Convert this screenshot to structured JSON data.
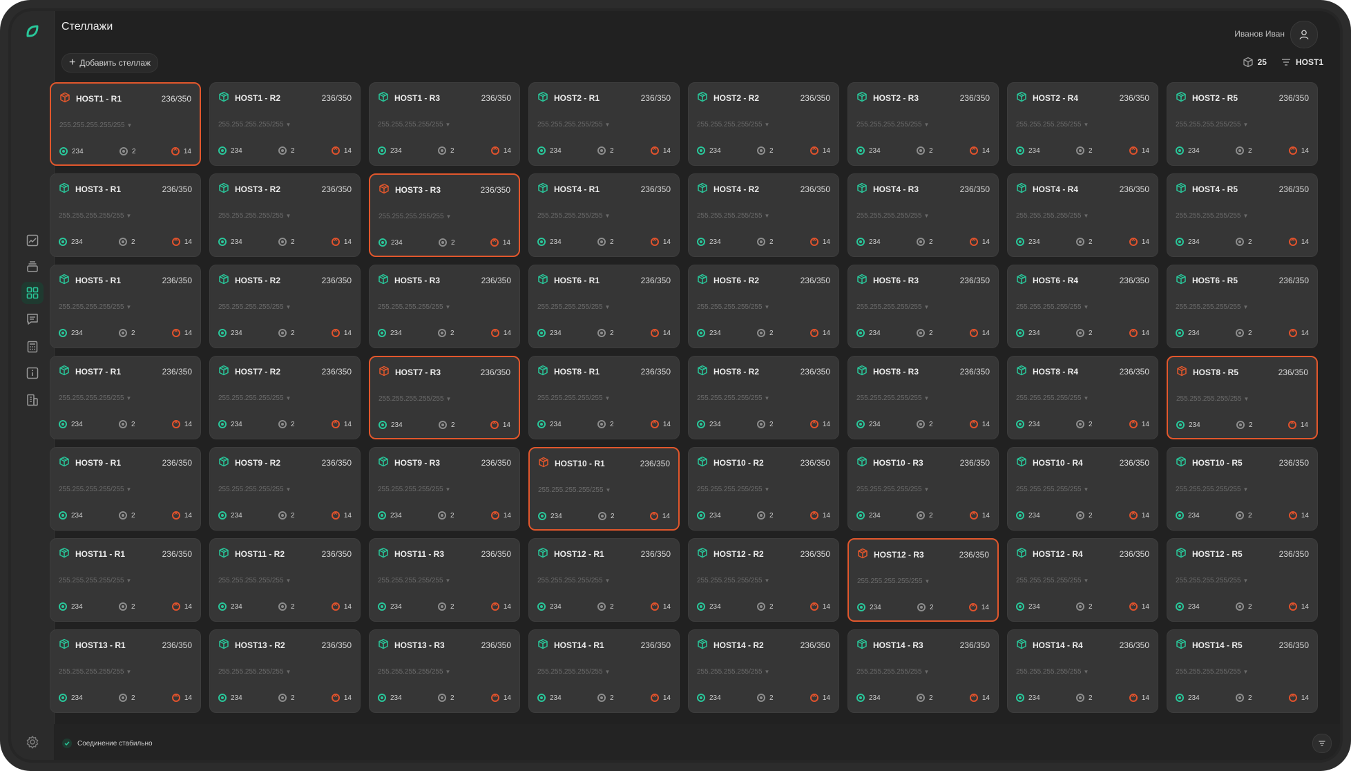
{
  "app": {
    "page_title": "Стеллажи",
    "user_name": "Иванов Иван",
    "add_button_label": "Добавить стеллаж",
    "rack_count": "25",
    "filter_host": "HOST1",
    "footer_status": "Соединение стабильно"
  },
  "colors": {
    "accent": "#29c79a",
    "alert": "#e2572c",
    "background": "#212121",
    "card": "#363636"
  },
  "sidebar": {
    "items": [
      {
        "icon": "chart-icon"
      },
      {
        "icon": "layers-icon"
      },
      {
        "icon": "grid-icon",
        "active": true
      },
      {
        "icon": "message-icon"
      },
      {
        "icon": "calculator-icon"
      },
      {
        "icon": "info-icon"
      },
      {
        "icon": "building-icon"
      }
    ]
  },
  "racks": [
    {
      "name": "HOST1 - R1",
      "capacity": "236/350",
      "ip": "255.255.255.255/255",
      "ok": "234",
      "warn": "2",
      "err": "14",
      "alert": true
    },
    {
      "name": "HOST1 - R2",
      "capacity": "236/350",
      "ip": "255.255.255.255/255",
      "ok": "234",
      "warn": "2",
      "err": "14",
      "alert": false
    },
    {
      "name": "HOST1 - R3",
      "capacity": "236/350",
      "ip": "255.255.255.255/255",
      "ok": "234",
      "warn": "2",
      "err": "14",
      "alert": false
    },
    {
      "name": "HOST2 - R1",
      "capacity": "236/350",
      "ip": "255.255.255.255/255",
      "ok": "234",
      "warn": "2",
      "err": "14",
      "alert": false
    },
    {
      "name": "HOST2 - R2",
      "capacity": "236/350",
      "ip": "255.255.255.255/255",
      "ok": "234",
      "warn": "2",
      "err": "14",
      "alert": false
    },
    {
      "name": "HOST2 - R3",
      "capacity": "236/350",
      "ip": "255.255.255.255/255",
      "ok": "234",
      "warn": "2",
      "err": "14",
      "alert": false
    },
    {
      "name": "HOST2 - R4",
      "capacity": "236/350",
      "ip": "255.255.255.255/255",
      "ok": "234",
      "warn": "2",
      "err": "14",
      "alert": false
    },
    {
      "name": "HOST2 - R5",
      "capacity": "236/350",
      "ip": "255.255.255.255/255",
      "ok": "234",
      "warn": "2",
      "err": "14",
      "alert": false
    },
    {
      "name": "HOST3 - R1",
      "capacity": "236/350",
      "ip": "255.255.255.255/255",
      "ok": "234",
      "warn": "2",
      "err": "14",
      "alert": false
    },
    {
      "name": "HOST3 - R2",
      "capacity": "236/350",
      "ip": "255.255.255.255/255",
      "ok": "234",
      "warn": "2",
      "err": "14",
      "alert": false
    },
    {
      "name": "HOST3 - R3",
      "capacity": "236/350",
      "ip": "255.255.255.255/255",
      "ok": "234",
      "warn": "2",
      "err": "14",
      "alert": true
    },
    {
      "name": "HOST4 - R1",
      "capacity": "236/350",
      "ip": "255.255.255.255/255",
      "ok": "234",
      "warn": "2",
      "err": "14",
      "alert": false
    },
    {
      "name": "HOST4 - R2",
      "capacity": "236/350",
      "ip": "255.255.255.255/255",
      "ok": "234",
      "warn": "2",
      "err": "14",
      "alert": false
    },
    {
      "name": "HOST4 - R3",
      "capacity": "236/350",
      "ip": "255.255.255.255/255",
      "ok": "234",
      "warn": "2",
      "err": "14",
      "alert": false
    },
    {
      "name": "HOST4 - R4",
      "capacity": "236/350",
      "ip": "255.255.255.255/255",
      "ok": "234",
      "warn": "2",
      "err": "14",
      "alert": false
    },
    {
      "name": "HOST4 - R5",
      "capacity": "236/350",
      "ip": "255.255.255.255/255",
      "ok": "234",
      "warn": "2",
      "err": "14",
      "alert": false
    },
    {
      "name": "HOST5 - R1",
      "capacity": "236/350",
      "ip": "255.255.255.255/255",
      "ok": "234",
      "warn": "2",
      "err": "14",
      "alert": false
    },
    {
      "name": "HOST5 - R2",
      "capacity": "236/350",
      "ip": "255.255.255.255/255",
      "ok": "234",
      "warn": "2",
      "err": "14",
      "alert": false
    },
    {
      "name": "HOST5 - R3",
      "capacity": "236/350",
      "ip": "255.255.255.255/255",
      "ok": "234",
      "warn": "2",
      "err": "14",
      "alert": false
    },
    {
      "name": "HOST6 - R1",
      "capacity": "236/350",
      "ip": "255.255.255.255/255",
      "ok": "234",
      "warn": "2",
      "err": "14",
      "alert": false
    },
    {
      "name": "HOST6 - R2",
      "capacity": "236/350",
      "ip": "255.255.255.255/255",
      "ok": "234",
      "warn": "2",
      "err": "14",
      "alert": false
    },
    {
      "name": "HOST6 - R3",
      "capacity": "236/350",
      "ip": "255.255.255.255/255",
      "ok": "234",
      "warn": "2",
      "err": "14",
      "alert": false
    },
    {
      "name": "HOST6 - R4",
      "capacity": "236/350",
      "ip": "255.255.255.255/255",
      "ok": "234",
      "warn": "2",
      "err": "14",
      "alert": false
    },
    {
      "name": "HOST6 - R5",
      "capacity": "236/350",
      "ip": "255.255.255.255/255",
      "ok": "234",
      "warn": "2",
      "err": "14",
      "alert": false
    },
    {
      "name": "HOST7 - R1",
      "capacity": "236/350",
      "ip": "255.255.255.255/255",
      "ok": "234",
      "warn": "2",
      "err": "14",
      "alert": false
    },
    {
      "name": "HOST7 - R2",
      "capacity": "236/350",
      "ip": "255.255.255.255/255",
      "ok": "234",
      "warn": "2",
      "err": "14",
      "alert": false
    },
    {
      "name": "HOST7 - R3",
      "capacity": "236/350",
      "ip": "255.255.255.255/255",
      "ok": "234",
      "warn": "2",
      "err": "14",
      "alert": true
    },
    {
      "name": "HOST8 - R1",
      "capacity": "236/350",
      "ip": "255.255.255.255/255",
      "ok": "234",
      "warn": "2",
      "err": "14",
      "alert": false
    },
    {
      "name": "HOST8 - R2",
      "capacity": "236/350",
      "ip": "255.255.255.255/255",
      "ok": "234",
      "warn": "2",
      "err": "14",
      "alert": false
    },
    {
      "name": "HOST8 - R3",
      "capacity": "236/350",
      "ip": "255.255.255.255/255",
      "ok": "234",
      "warn": "2",
      "err": "14",
      "alert": false
    },
    {
      "name": "HOST8 - R4",
      "capacity": "236/350",
      "ip": "255.255.255.255/255",
      "ok": "234",
      "warn": "2",
      "err": "14",
      "alert": false
    },
    {
      "name": "HOST8 - R5",
      "capacity": "236/350",
      "ip": "255.255.255.255/255",
      "ok": "234",
      "warn": "2",
      "err": "14",
      "alert": true
    },
    {
      "name": "HOST9 - R1",
      "capacity": "236/350",
      "ip": "255.255.255.255/255",
      "ok": "234",
      "warn": "2",
      "err": "14",
      "alert": false
    },
    {
      "name": "HOST9 - R2",
      "capacity": "236/350",
      "ip": "255.255.255.255/255",
      "ok": "234",
      "warn": "2",
      "err": "14",
      "alert": false
    },
    {
      "name": "HOST9 - R3",
      "capacity": "236/350",
      "ip": "255.255.255.255/255",
      "ok": "234",
      "warn": "2",
      "err": "14",
      "alert": false
    },
    {
      "name": "HOST10 - R1",
      "capacity": "236/350",
      "ip": "255.255.255.255/255",
      "ok": "234",
      "warn": "2",
      "err": "14",
      "alert": true
    },
    {
      "name": "HOST10 - R2",
      "capacity": "236/350",
      "ip": "255.255.255.255/255",
      "ok": "234",
      "warn": "2",
      "err": "14",
      "alert": false
    },
    {
      "name": "HOST10 - R3",
      "capacity": "236/350",
      "ip": "255.255.255.255/255",
      "ok": "234",
      "warn": "2",
      "err": "14",
      "alert": false
    },
    {
      "name": "HOST10 - R4",
      "capacity": "236/350",
      "ip": "255.255.255.255/255",
      "ok": "234",
      "warn": "2",
      "err": "14",
      "alert": false
    },
    {
      "name": "HOST10 - R5",
      "capacity": "236/350",
      "ip": "255.255.255.255/255",
      "ok": "234",
      "warn": "2",
      "err": "14",
      "alert": false
    },
    {
      "name": "HOST11 - R1",
      "capacity": "236/350",
      "ip": "255.255.255.255/255",
      "ok": "234",
      "warn": "2",
      "err": "14",
      "alert": false
    },
    {
      "name": "HOST11 - R2",
      "capacity": "236/350",
      "ip": "255.255.255.255/255",
      "ok": "234",
      "warn": "2",
      "err": "14",
      "alert": false
    },
    {
      "name": "HOST11 - R3",
      "capacity": "236/350",
      "ip": "255.255.255.255/255",
      "ok": "234",
      "warn": "2",
      "err": "14",
      "alert": false
    },
    {
      "name": "HOST12 - R1",
      "capacity": "236/350",
      "ip": "255.255.255.255/255",
      "ok": "234",
      "warn": "2",
      "err": "14",
      "alert": false
    },
    {
      "name": "HOST12 - R2",
      "capacity": "236/350",
      "ip": "255.255.255.255/255",
      "ok": "234",
      "warn": "2",
      "err": "14",
      "alert": false
    },
    {
      "name": "HOST12 - R3",
      "capacity": "236/350",
      "ip": "255.255.255.255/255",
      "ok": "234",
      "warn": "2",
      "err": "14",
      "alert": true
    },
    {
      "name": "HOST12 - R4",
      "capacity": "236/350",
      "ip": "255.255.255.255/255",
      "ok": "234",
      "warn": "2",
      "err": "14",
      "alert": false
    },
    {
      "name": "HOST12 - R5",
      "capacity": "236/350",
      "ip": "255.255.255.255/255",
      "ok": "234",
      "warn": "2",
      "err": "14",
      "alert": false
    },
    {
      "name": "HOST13 - R1",
      "capacity": "236/350",
      "ip": "255.255.255.255/255",
      "ok": "234",
      "warn": "2",
      "err": "14",
      "alert": false
    },
    {
      "name": "HOST13 - R2",
      "capacity": "236/350",
      "ip": "255.255.255.255/255",
      "ok": "234",
      "warn": "2",
      "err": "14",
      "alert": false
    },
    {
      "name": "HOST13 - R3",
      "capacity": "236/350",
      "ip": "255.255.255.255/255",
      "ok": "234",
      "warn": "2",
      "err": "14",
      "alert": false
    },
    {
      "name": "HOST14 - R1",
      "capacity": "236/350",
      "ip": "255.255.255.255/255",
      "ok": "234",
      "warn": "2",
      "err": "14",
      "alert": false
    },
    {
      "name": "HOST14 - R2",
      "capacity": "236/350",
      "ip": "255.255.255.255/255",
      "ok": "234",
      "warn": "2",
      "err": "14",
      "alert": false
    },
    {
      "name": "HOST14 - R3",
      "capacity": "236/350",
      "ip": "255.255.255.255/255",
      "ok": "234",
      "warn": "2",
      "err": "14",
      "alert": false
    },
    {
      "name": "HOST14 - R4",
      "capacity": "236/350",
      "ip": "255.255.255.255/255",
      "ok": "234",
      "warn": "2",
      "err": "14",
      "alert": false
    },
    {
      "name": "HOST14 - R5",
      "capacity": "236/350",
      "ip": "255.255.255.255/255",
      "ok": "234",
      "warn": "2",
      "err": "14",
      "alert": false
    }
  ]
}
